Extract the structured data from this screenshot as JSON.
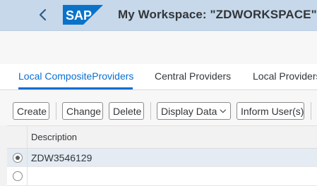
{
  "shell": {
    "title": "My Workspace: \"ZDWORKSPACE\"",
    "title_overflow": "E",
    "logo_text": "SAP",
    "colors": {
      "shellbar": "#c6d8ea",
      "logo_blue": "#0a73c9",
      "accent": "#0a6ed1"
    }
  },
  "tabs": [
    {
      "label": "Local CompositeProviders",
      "active": true
    },
    {
      "label": "Central Providers",
      "active": false
    },
    {
      "label": "Local Providers",
      "active": false
    }
  ],
  "actions": {
    "create": "Create",
    "change": "Change",
    "delete": "Delete",
    "display_data": "Display Data",
    "inform_users": "Inform User(s)"
  },
  "table": {
    "columns": [
      "Description"
    ],
    "rows": [
      {
        "description": "ZDW3546129",
        "selected": true
      },
      {
        "description": "",
        "selected": false
      }
    ]
  },
  "icons": [
    "back-arrow-icon",
    "sap-logo",
    "chevron-down-icon",
    "radio-button-icon"
  ]
}
